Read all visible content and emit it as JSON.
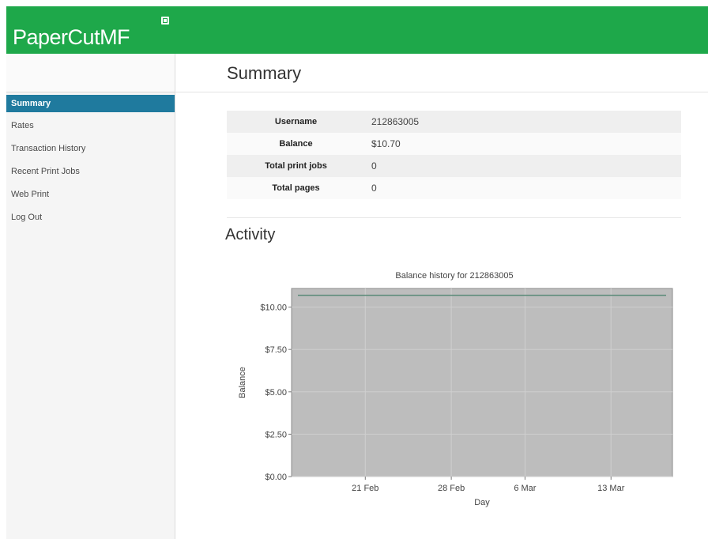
{
  "brand": {
    "name": "PaperCutMF"
  },
  "nav": {
    "items": [
      {
        "label": "Summary",
        "active": true
      },
      {
        "label": "Rates",
        "active": false
      },
      {
        "label": "Transaction History",
        "active": false
      },
      {
        "label": "Recent Print Jobs",
        "active": false
      },
      {
        "label": "Web Print",
        "active": false
      },
      {
        "label": "Log Out",
        "active": false
      }
    ]
  },
  "page": {
    "title": "Summary",
    "summary": [
      {
        "label": "Username",
        "value": "212863005"
      },
      {
        "label": "Balance",
        "value": "$10.70"
      },
      {
        "label": "Total print jobs",
        "value": "0"
      },
      {
        "label": "Total pages",
        "value": "0"
      }
    ],
    "activity_title": "Activity"
  },
  "colors": {
    "header": "#1ea84a",
    "nav_active": "#1f7a9e",
    "plot_bg": "#bdbdbd",
    "line": "#5a8a78"
  },
  "chart_data": {
    "type": "line",
    "title": "Balance history for 212863005",
    "xlabel": "Day",
    "ylabel": "Balance",
    "x_ticks": [
      "21 Feb",
      "28 Feb",
      "6 Mar",
      "13 Mar"
    ],
    "y_ticks": [
      "$0.00",
      "$2.50",
      "$5.00",
      "$7.50",
      "$10.00"
    ],
    "ylim": [
      0,
      11.1
    ],
    "x_range": [
      "2017-02-15",
      "2017-03-18"
    ],
    "series": [
      {
        "x": [
          "2017-02-15",
          "2017-03-18"
        ],
        "values": [
          10.7,
          10.7
        ]
      }
    ],
    "grid": true
  }
}
